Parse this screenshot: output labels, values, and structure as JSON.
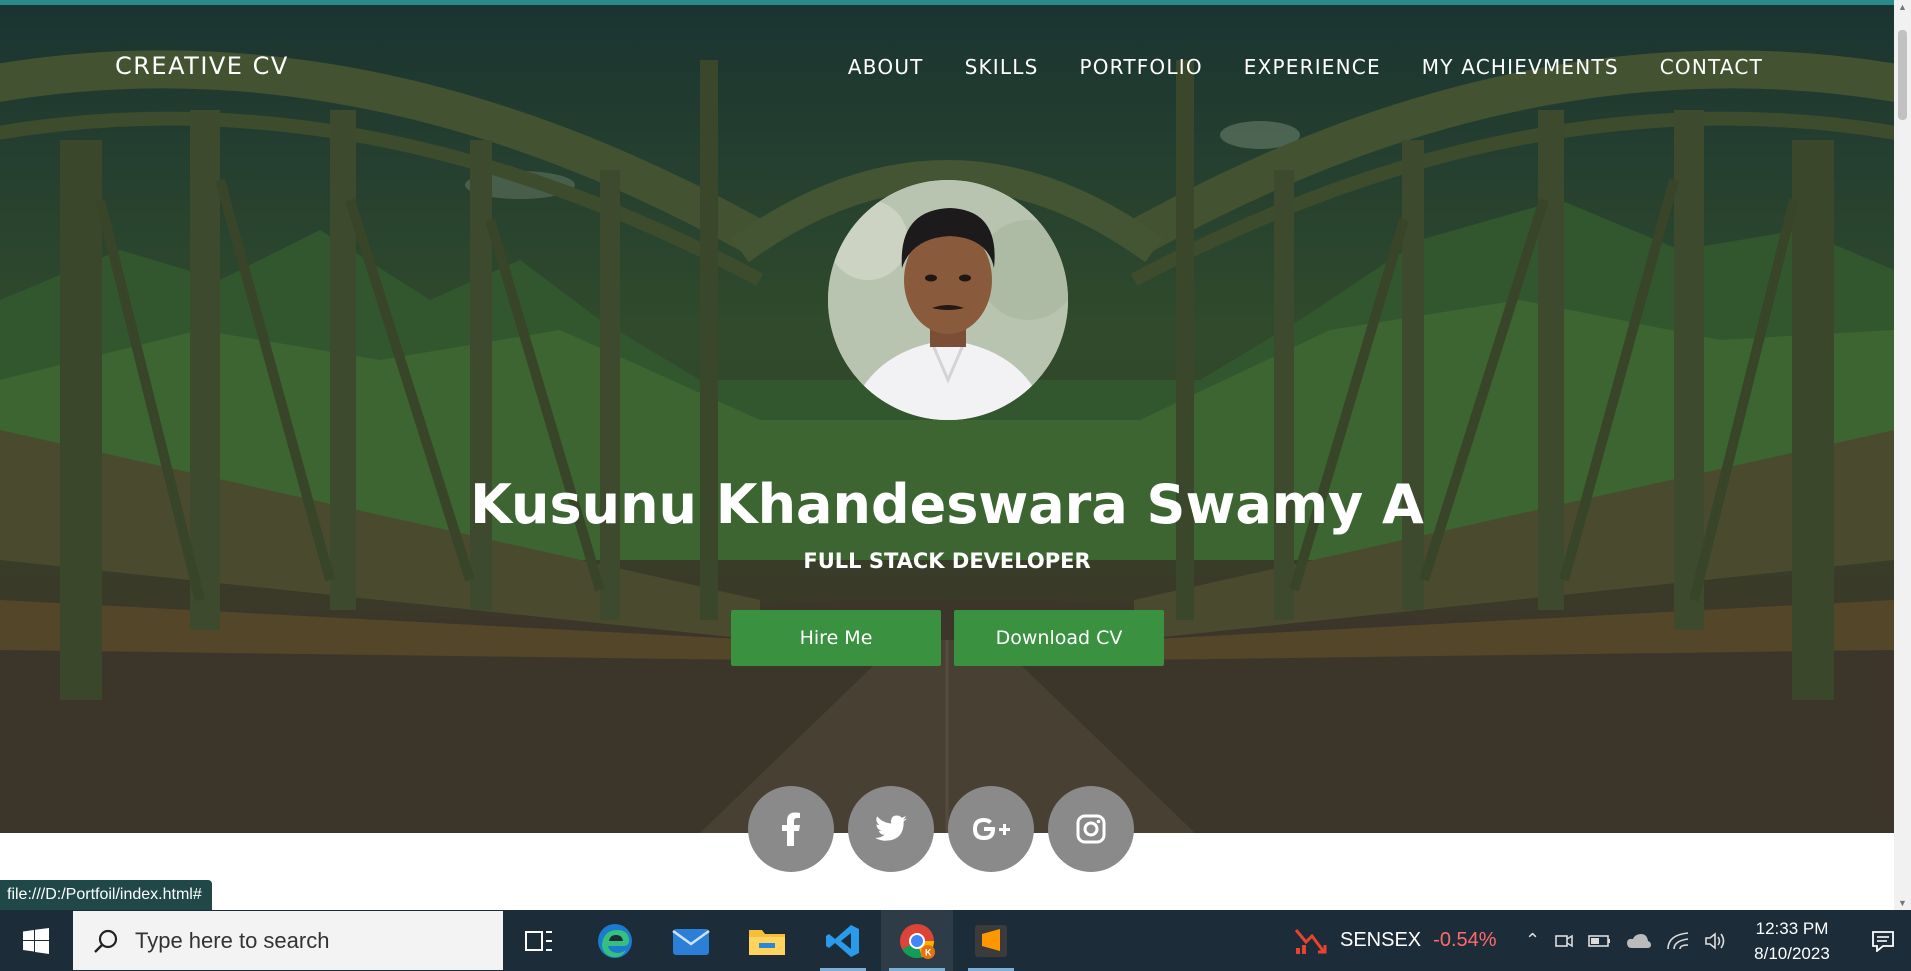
{
  "site": {
    "brand": "CREATIVE CV",
    "nav": [
      "ABOUT",
      "SKILLS",
      "PORTFOLIO",
      "EXPERIENCE",
      "MY ACHIEVMENTS",
      "CONTACT"
    ],
    "name": "Kusunu Khandeswara Swamy A",
    "role": "FULL STACK DEVELOPER",
    "hire_label": "Hire Me",
    "download_label": "Download CV",
    "socials": [
      "facebook-icon",
      "twitter-icon",
      "google-plus-icon",
      "instagram-icon"
    ],
    "button_color": "#3a9140"
  },
  "status_url": "file:///D:/Portfoil/index.html#",
  "taskbar": {
    "search_placeholder": "Type here to search",
    "apps": [
      "task-view-icon",
      "edge-icon",
      "mail-icon",
      "file-explorer-icon",
      "vscode-icon",
      "chrome-icon",
      "sublime-icon"
    ],
    "sensex_label": "SENSEX",
    "sensex_change": "-0.54%",
    "time": "12:33 PM",
    "date": "8/10/2023"
  }
}
